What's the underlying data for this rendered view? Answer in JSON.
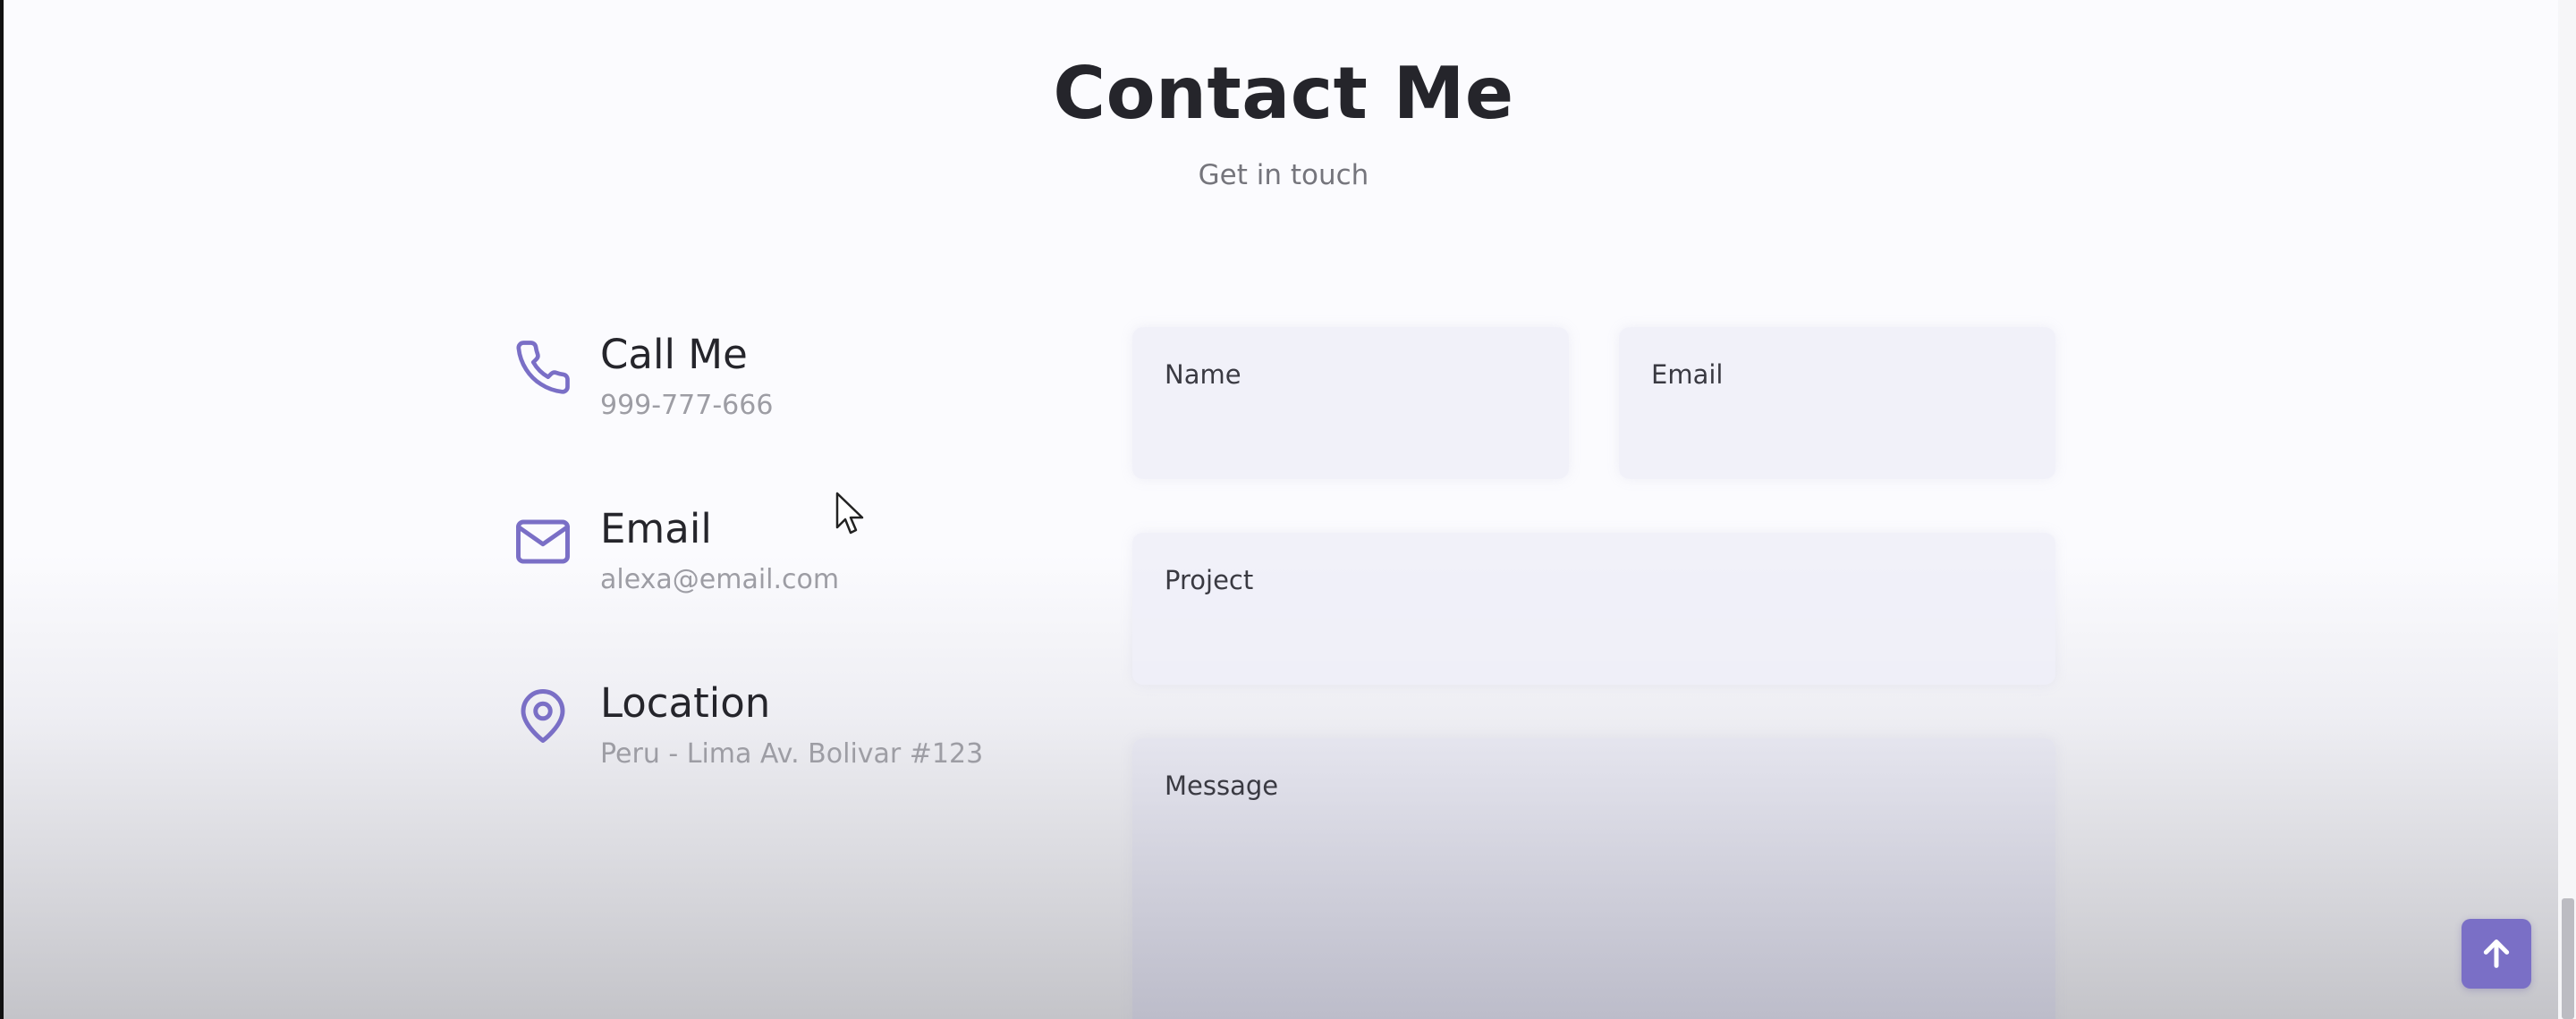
{
  "contact": {
    "title": "Contact Me",
    "subtitle": "Get in touch"
  },
  "info": [
    {
      "title": "Call Me",
      "subtitle": "999-777-666",
      "icon": "phone-icon"
    },
    {
      "title": "Email",
      "subtitle": "alexa@email.com",
      "icon": "mail-icon"
    },
    {
      "title": "Location",
      "subtitle": "Peru - Lima Av. Bolivar #123",
      "icon": "location-pin-icon"
    }
  ],
  "form": {
    "name_label": "Name",
    "email_label": "Email",
    "project_label": "Project",
    "message_label": "Message"
  },
  "colors": {
    "accent": "#7a6fc6",
    "title": "#25252b",
    "muted": "#9d9da4"
  },
  "scroll_up_icon": "arrow-up-icon"
}
